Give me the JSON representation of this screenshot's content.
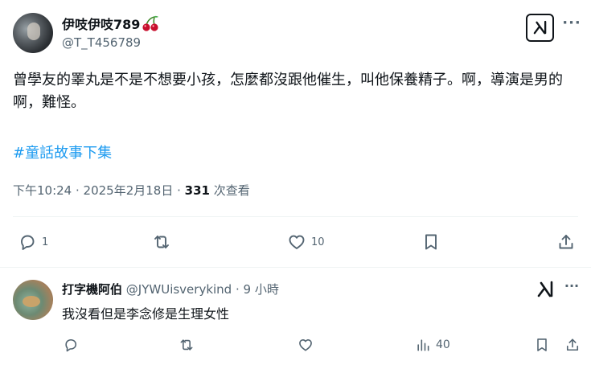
{
  "main": {
    "display_name": "伊吱伊吱789",
    "emoji": "cherries-emoji",
    "handle": "@T_T456789",
    "text": "曾學友的睪丸是不是不想要小孩，怎麼都沒跟他催生，叫他保養精子。啊，導演是男的啊，難怪。",
    "hashtag": "#童話故事下集",
    "time": "下午10:24 · 2025年2月18日 · ",
    "views_count": "331",
    "views_label": " 次查看",
    "actions": {
      "reply_count": "1",
      "retweet_count": "",
      "like_count": "10"
    }
  },
  "reply": {
    "display_name": "打字機阿伯",
    "handle": "@JYWUisverykind",
    "time": " · 9 小時",
    "text": "我沒看但是李念修是生理女性",
    "actions": {
      "views_count": "40"
    }
  },
  "colors": {
    "link": "#1d9bf0",
    "muted": "#536471",
    "text": "#0f1419",
    "divider": "#eff3f4"
  }
}
